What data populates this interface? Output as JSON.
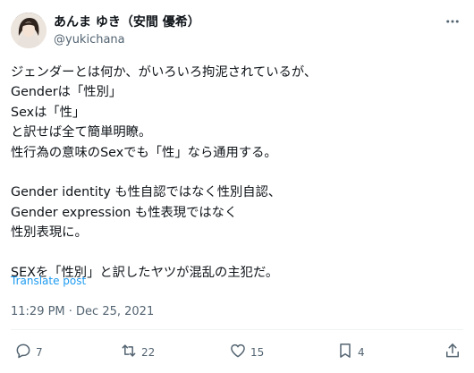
{
  "author": {
    "display_name": "あんま ゆき（安間 優希）",
    "handle": "@yukichana"
  },
  "tweet": {
    "lines": [
      "ジェンダーとは何か、がいろいろ拘泥されているが、",
      "Genderは「性別」",
      "Sexは「性」",
      "と訳せば全て簡単明瞭。",
      "性行為の意味のSexでも「性」なら通用する。",
      "",
      "Gender identity も性自認ではなく性別自認、",
      "Gender expression も性表現ではなく",
      "性別表現に。",
      "",
      "SEXを「性別」と訳したヤツが混乱の主犯だ。"
    ],
    "translate_label": "Translate post",
    "timestamp": "11:29 PM · Dec 25, 2021"
  },
  "actions": {
    "replies": "7",
    "reposts": "22",
    "likes": "15",
    "bookmarks": "4"
  },
  "icons": {
    "more": "more-horizontal-icon",
    "reply": "reply-icon",
    "repost": "repost-icon",
    "like": "heart-icon",
    "bookmark": "bookmark-icon",
    "share": "share-icon"
  },
  "colors": {
    "text": "#0f1419",
    "secondary": "#536471",
    "link": "#1d9bf0",
    "divider": "#eff3f4"
  }
}
